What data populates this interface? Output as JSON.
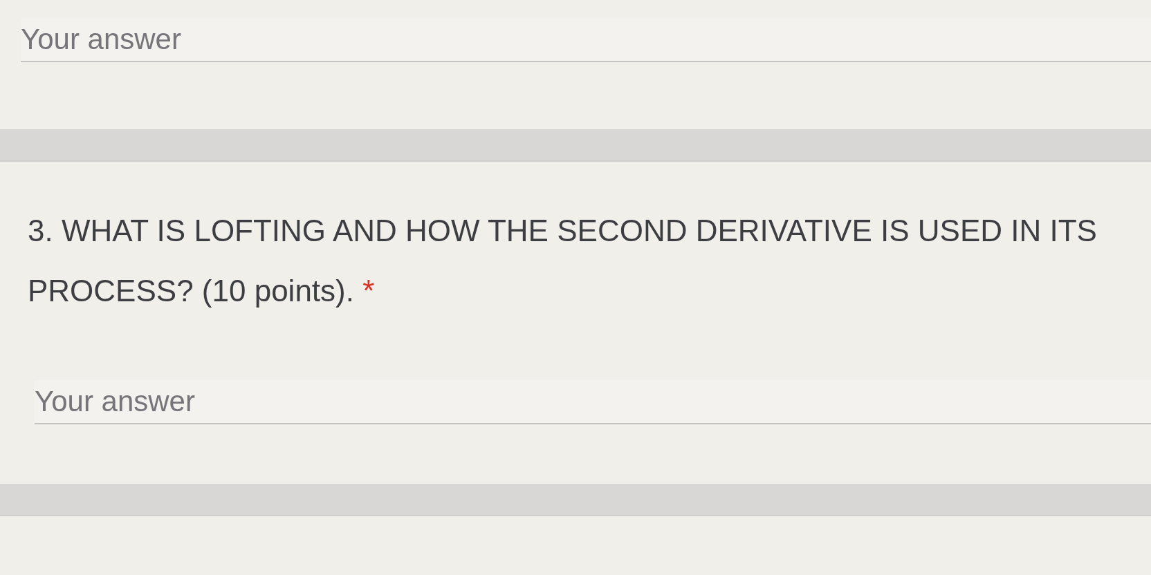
{
  "form": {
    "cards": [
      {
        "kind": "answer",
        "answer_field": {
          "placeholder": "Your answer"
        }
      },
      {
        "kind": "question",
        "title": "3. WHAT IS LOFTING AND HOW THE SECOND DERIVATIVE IS USED IN ITS PROCESS? (10 points).",
        "required_mark": "*",
        "answer_field": {
          "placeholder": "Your answer"
        }
      },
      {
        "kind": "blank"
      }
    ]
  }
}
